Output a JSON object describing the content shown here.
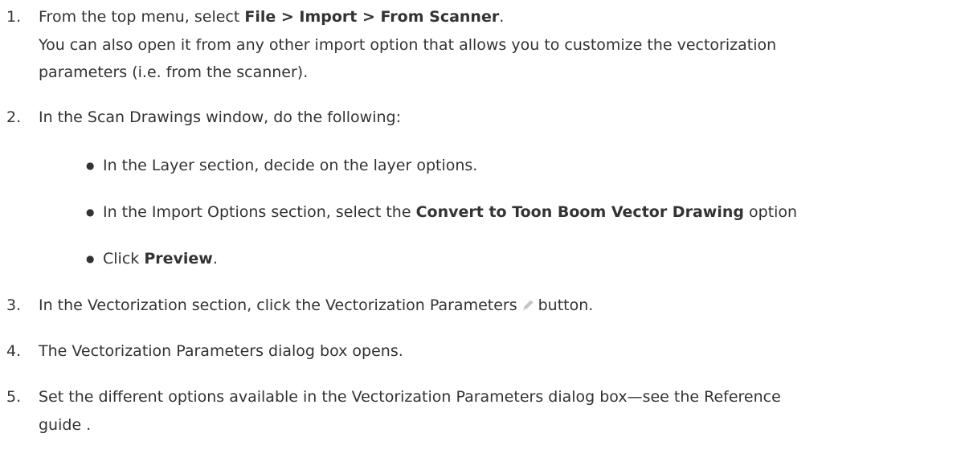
{
  "steps": [
    {
      "num": "1.",
      "pre": "From the top menu, select ",
      "bold": "File > Import > From Scanner",
      "post": ".",
      "note_line1": "You can also open it from any other import option that allows you to customize the vectorization",
      "note_line2": "parameters (i.e. from the scanner)."
    },
    {
      "num": "2.",
      "text": "In the Scan Drawings window, do the following:",
      "bullets": [
        {
          "pre": "In the Layer section, decide on the layer options.",
          "bold": "",
          "post": ""
        },
        {
          "pre": "In the Import Options section, select the ",
          "bold": "Convert to Toon Boom Vector Drawing",
          "post": " option"
        },
        {
          "pre": "Click ",
          "bold": "Preview",
          "post": "."
        }
      ]
    },
    {
      "num": "3.",
      "pre": "In the Vectorization section, click the Vectorization Parameters",
      "icon": "pencil-icon",
      "post": "button."
    },
    {
      "num": "4.",
      "text": "The Vectorization Parameters dialog box opens."
    },
    {
      "num": "5.",
      "line1": "Set the different options available in the Vectorization Parameters dialog box—see the Reference",
      "line2": "guide ."
    }
  ],
  "bullet_char": "●",
  "colors": {
    "text": "#333333",
    "icon": "#bbbbbb"
  }
}
